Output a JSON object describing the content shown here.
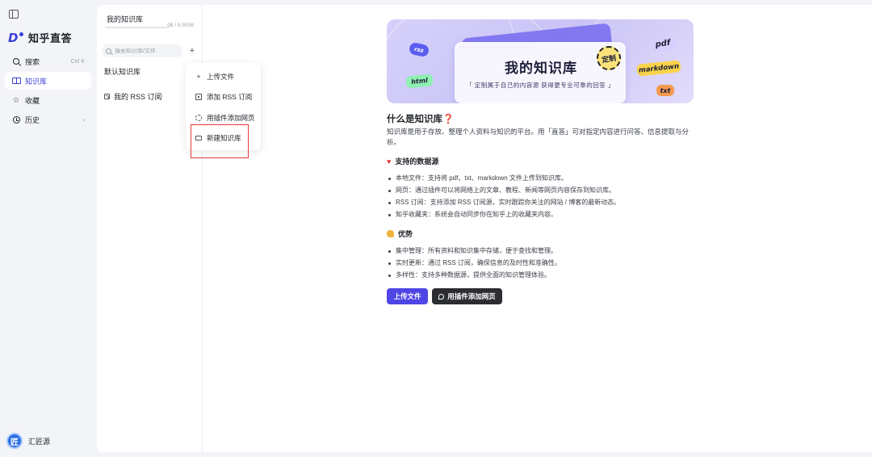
{
  "app": {
    "brand": "知乎直答"
  },
  "sidebar": {
    "items": [
      {
        "label": "搜索",
        "icon": "search-icon",
        "shortcut": "Ctrl  K",
        "active": false
      },
      {
        "label": "知识库",
        "icon": "book-icon",
        "active": true
      },
      {
        "label": "收藏",
        "icon": "star-icon",
        "active": false
      },
      {
        "label": "历史",
        "icon": "clock-icon",
        "active": false,
        "has_chevron": true
      }
    ],
    "user": {
      "avatar_text": "匠",
      "name": "汇匠源"
    }
  },
  "kb_panel": {
    "title": "我的知识库",
    "usage": "0B / 5.00GB",
    "usage_fraction": 0.0,
    "search_placeholder": "搜索知识库/文件",
    "add_icon": "+",
    "items": [
      {
        "label": "默认知识库"
      },
      {
        "label": "我的 RSS 订阅",
        "icon": "rss-icon"
      }
    ]
  },
  "dropdown": {
    "items": [
      {
        "label": "上传文件",
        "icon": "plus-icon"
      },
      {
        "label": "添加 RSS 订阅",
        "icon": "rss-square-icon"
      },
      {
        "label": "用插件添加网页",
        "icon": "plugin-icon"
      },
      {
        "label": "新建知识库",
        "icon": "folder-icon",
        "highlighted": true
      }
    ],
    "highlight_color": "#e23b3b"
  },
  "banner": {
    "title": "我的知识库",
    "subtitle": "「 定制属于自己的内容源  获得更专业可靠的回答 」",
    "badge": "定制",
    "stickers": [
      "rss",
      "html",
      "pdf",
      "markdown",
      "txt"
    ]
  },
  "content": {
    "heading": "什么是知识库",
    "heading_mark": "❓",
    "intro": "知识库是用于存放、整理个人资料与知识的平台。用「直答」可对指定内容进行问答、信息提取与分析。",
    "sources_title": "支持的数据源",
    "sources": [
      "本地文件：支持将 pdf、txt、markdown 文件上传到知识库。",
      "网页：通过插件可以将网络上的文章、教程、新闻等网页内容保存到知识库。",
      "RSS 订阅：支持添加 RSS 订阅源，实时跟踪你关注的网站 / 博客的最新动态。",
      "知乎收藏夹：系统会自动同步你在知乎上的收藏夹内容。"
    ],
    "advantages_title": "优势",
    "advantages": [
      "集中管理：所有资料和知识集中存储，便于查找和管理。",
      "实时更新：通过 RSS 订阅，确保信息的及时性和准确性。",
      "多样性：支持多种数据源，提供全面的知识管理体验。"
    ],
    "upload_button": "上传文件",
    "plugin_button": "用插件添加网页"
  },
  "colors": {
    "accent": "#3b3fd9",
    "primary_button": "#4f46e5",
    "dark_button": "#2b2d31",
    "background": "#f3f4f8"
  }
}
